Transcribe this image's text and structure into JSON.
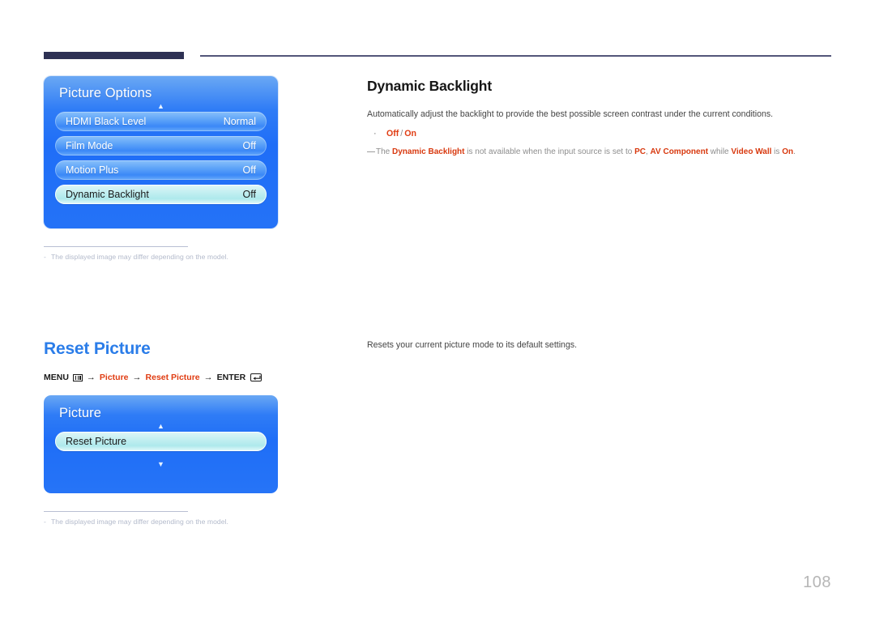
{
  "page": {
    "number": "108"
  },
  "sections": [
    {
      "heading": "Dynamic Backlight",
      "heading_color": "#161616",
      "description": "Automatically adjust the backlight to provide the best possible screen contrast under the current conditions.",
      "bullet": {
        "marker": "·",
        "option_off": "Off",
        "separator": "/",
        "option_on": "On"
      },
      "note": {
        "dash": "—",
        "part1": "The ",
        "bold1": "Dynamic Backlight",
        "part2": " is not available when the input source is set to ",
        "bold2": "PC",
        "part3": ", ",
        "bold3": "AV Component",
        "part4": " while ",
        "bold4": "Video Wall",
        "part5": " is ",
        "bold5": "On",
        "part6": "."
      }
    },
    {
      "heading": "Reset Picture",
      "heading_color": "#2b7de9",
      "description": "Resets your current picture mode to its default settings."
    }
  ],
  "menu_path": {
    "menu_label": "MENU",
    "menu_icon": "menu-bars-icon",
    "arrow": "→",
    "step1": "Picture",
    "step2": "Reset Picture",
    "enter_label": "ENTER",
    "enter_icon": "enter-key-icon",
    "red_color": "#e03c12"
  },
  "osd_panels": [
    {
      "title": "Picture Options",
      "scroll_up": "▲",
      "rows": [
        {
          "label": "HDMI Black Level",
          "value": "Normal",
          "selected": false
        },
        {
          "label": "Film Mode",
          "value": "Off",
          "selected": false
        },
        {
          "label": "Motion Plus",
          "value": "Off",
          "selected": false
        },
        {
          "label": "Dynamic Backlight",
          "value": "Off",
          "selected": true
        }
      ]
    },
    {
      "title": "Picture",
      "scroll_up": "▲",
      "scroll_down": "▼",
      "rows": [
        {
          "label": "Reset Picture",
          "value": "",
          "selected": true
        }
      ]
    }
  ],
  "footnotes": [
    {
      "dash": "-",
      "text": "The displayed image may differ depending on the model."
    },
    {
      "dash": "-",
      "text": "The displayed image may differ depending on the model."
    }
  ]
}
